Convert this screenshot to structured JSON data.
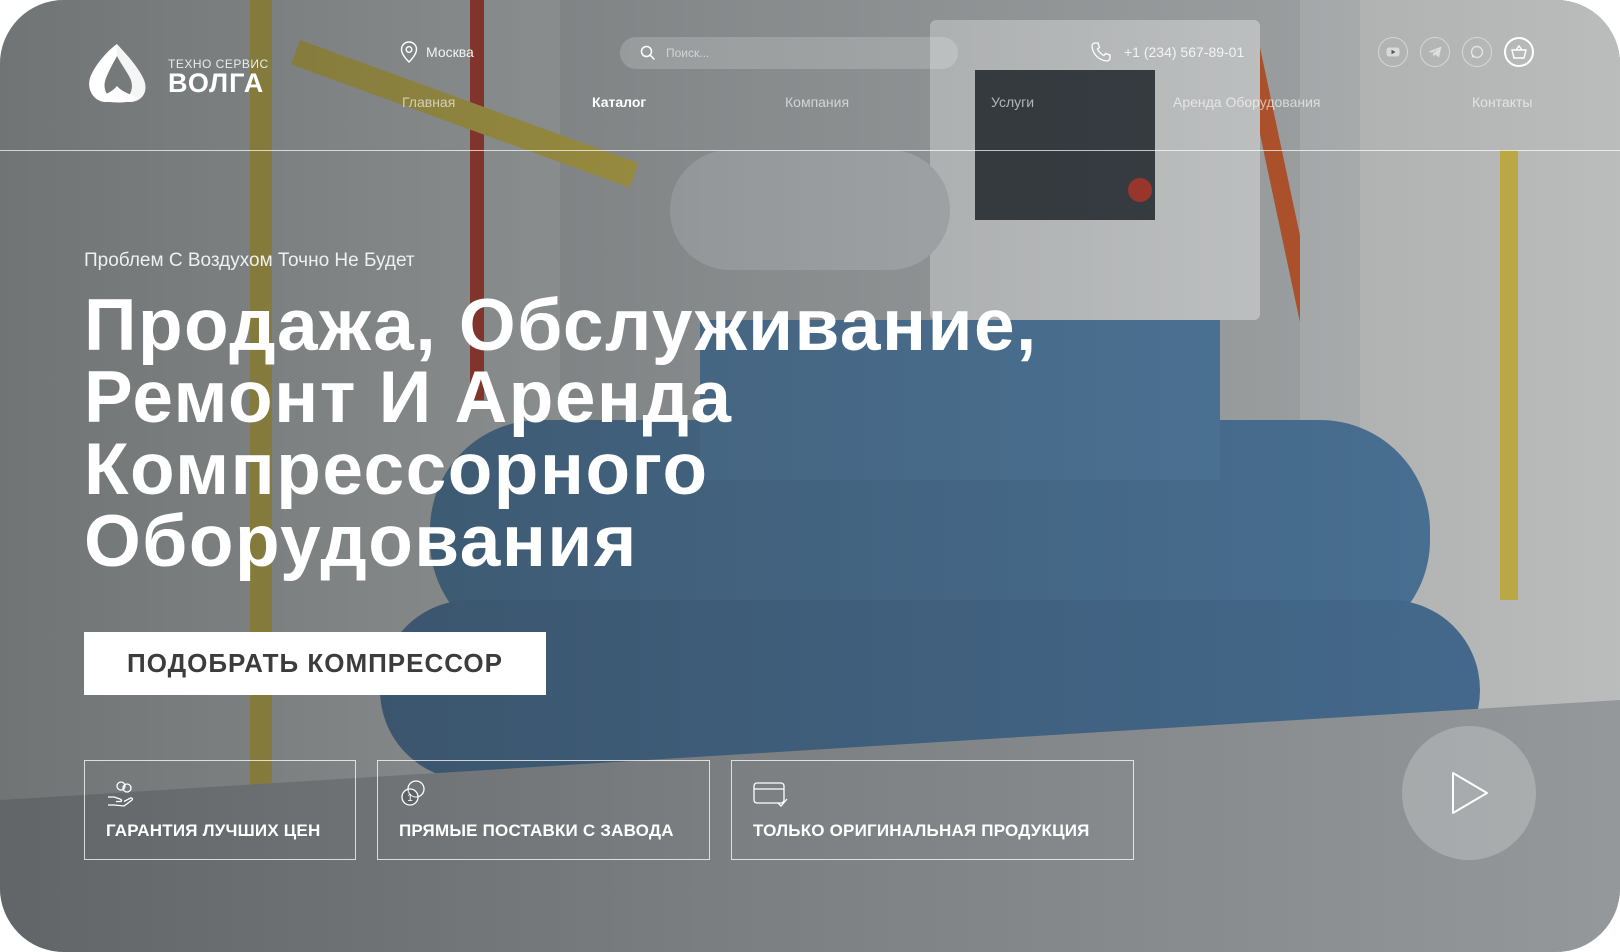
{
  "brand": {
    "line1": "ТЕХНО СЕРВИС",
    "line2": "ВОЛГА"
  },
  "header": {
    "city": "Москва",
    "search_placeholder": "Поиск...",
    "phone": "+1 (234) 567-89-01",
    "socials": [
      "youtube-icon",
      "telegram-icon",
      "whatsapp-icon",
      "cart-icon"
    ]
  },
  "nav": [
    {
      "label": "Главная",
      "active": false
    },
    {
      "label": "Каталог",
      "active": true
    },
    {
      "label": "Компания",
      "active": false
    },
    {
      "label": "Услуги",
      "active": false
    },
    {
      "label": "Аренда Оборудования",
      "active": false
    },
    {
      "label": "Контакты",
      "active": false
    }
  ],
  "hero": {
    "eyebrow": "Проблем С Воздухом Точно Не Будет",
    "title_lines": [
      "Продажа, Обслуживание,",
      "Ремонт И Аренда",
      "Компрессорного",
      "Оборудования"
    ],
    "cta": "ПОДОБРАТЬ КОМПРЕССОР"
  },
  "features": [
    {
      "label": "ГАРАНТИЯ ЛУЧШИХ ЦЕН",
      "icon": "coins-hand-icon"
    },
    {
      "label": "ПРЯМЫЕ ПОСТАВКИ С ЗАВОДА",
      "icon": "coin-stack-icon"
    },
    {
      "label": "ТОЛЬКО ОРИГИНАЛЬНАЯ ПРОДУКЦИЯ",
      "icon": "card-check-icon"
    }
  ],
  "colors": {
    "overlay": "#2a2f32",
    "text": "#ffffff",
    "cta_bg": "#ffffff",
    "cta_text": "#3c3c3c"
  }
}
